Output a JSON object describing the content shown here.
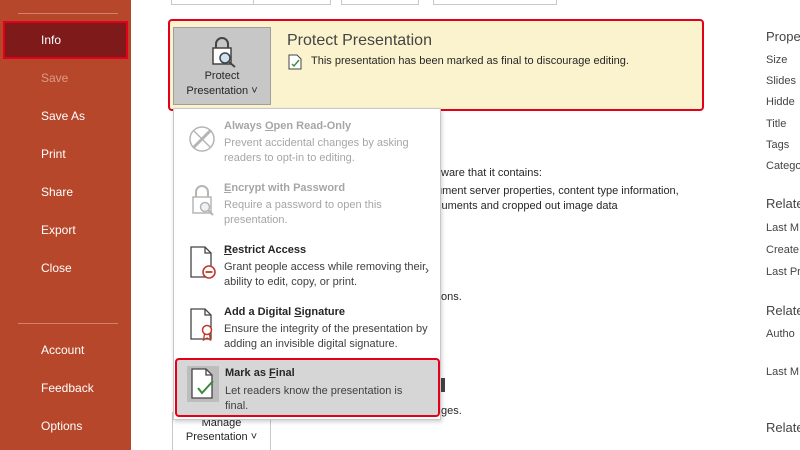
{
  "sidebar": {
    "items": [
      {
        "label": "Info"
      },
      {
        "label": "Save"
      },
      {
        "label": "Save As"
      },
      {
        "label": "Print"
      },
      {
        "label": "Share"
      },
      {
        "label": "Export"
      },
      {
        "label": "Close"
      },
      {
        "label": "Account"
      },
      {
        "label": "Feedback"
      },
      {
        "label": "Options"
      }
    ]
  },
  "protect": {
    "button_line1": "Protect",
    "button_line2": "Presentation ˅",
    "title": "Protect Presentation",
    "description": "This presentation has been marked as final to discourage editing."
  },
  "menu": {
    "items": [
      {
        "title_pre": "Always ",
        "title_u": "O",
        "title_post": "pen Read-Only",
        "desc": "Prevent accidental changes by asking readers to opt-in to editing."
      },
      {
        "title_pre": "",
        "title_u": "E",
        "title_post": "ncrypt with Password",
        "desc": "Require a password to open this presentation."
      },
      {
        "title_pre": "",
        "title_u": "R",
        "title_post": "estrict Access",
        "desc": "Grant people access while removing their ability to edit, copy, or print.",
        "chevron": "›"
      },
      {
        "title_pre": "Add a Digital ",
        "title_u": "S",
        "title_post": "ignature",
        "desc": "Ensure the integrity of the presentation by adding an invisible digital signature."
      },
      {
        "title_pre": "Mark as ",
        "title_u": "F",
        "title_post": "inal",
        "desc": "Let readers know the presentation is final."
      }
    ]
  },
  "manage": {
    "line1": "Manage",
    "line2": "Presentation ˅"
  },
  "background": {
    "line1": "ware that it contains:",
    "line2": "ument server properties, content type information,",
    "line3": "cuments and cropped out image data",
    "line4": "ons.",
    "line5": "ges."
  },
  "properties": {
    "heading": "Prope",
    "size": "Size",
    "slides": "Slides",
    "hidden": "Hidde",
    "title": "Title",
    "tags": "Tags",
    "categories": "Catego",
    "related_dates_heading": "Relate",
    "last_modified": "Last M",
    "created": "Create",
    "last_printed": "Last Pr",
    "related_people_heading": "Relate",
    "author": "Autho",
    "last_modified_by": "Last M",
    "related_docs_heading": "Relate"
  },
  "colors": {
    "sidebar": "#b7472a",
    "sidebar_active": "#7e1a1a",
    "banner": "#fbf3ce",
    "highlight_border": "#e4001b"
  }
}
